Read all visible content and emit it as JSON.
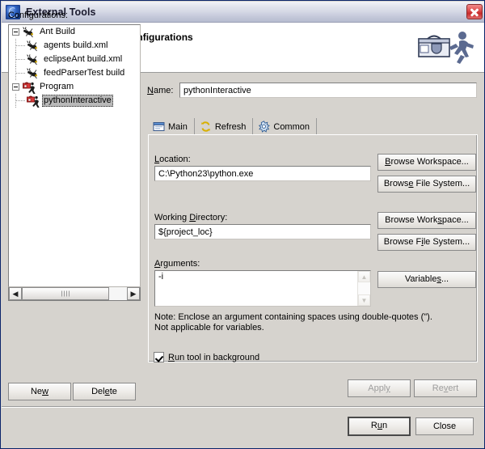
{
  "window": {
    "title": "External Tools",
    "app_icon": "eclipse-globe-icon",
    "close_icon": "close-icon"
  },
  "banner": {
    "title": "Create, manage, and run configurations",
    "icon": "external-tools-runner-icon"
  },
  "configurations": {
    "label": "Configurations:",
    "tree": [
      {
        "label": "Ant Build",
        "icon": "ant-icon",
        "level": 1,
        "expanded": true,
        "selected": false
      },
      {
        "label": "agents build.xml",
        "icon": "ant-icon",
        "level": 2,
        "expanded": false,
        "selected": false
      },
      {
        "label": "eclipseAnt build.xml",
        "icon": "ant-icon",
        "level": 2,
        "expanded": false,
        "selected": false
      },
      {
        "label": "feedParserTest build",
        "icon": "ant-icon",
        "level": 2,
        "expanded": false,
        "selected": false
      },
      {
        "label": "Program",
        "icon": "program-icon",
        "level": 1,
        "expanded": true,
        "selected": false
      },
      {
        "label": "pythonInteractive",
        "icon": "program-icon",
        "level": 2,
        "expanded": false,
        "selected": true
      }
    ],
    "scrollbar": {
      "left_arrow": "◀",
      "right_arrow": "▶",
      "name": "tree-horizontal-scrollbar"
    },
    "new_label": "New",
    "new_mnemonic": "w",
    "delete_label": "Delete",
    "delete_mnemonic": "e"
  },
  "details": {
    "name_label": "Name:",
    "name_mnemonic": "N",
    "name_value": "pythonInteractive",
    "name_placeholder": "",
    "tabs": [
      {
        "label": "Main",
        "icon": "main-window-icon",
        "active": true
      },
      {
        "label": "Refresh",
        "icon": "refresh-icon",
        "active": false
      },
      {
        "label": "Common",
        "icon": "common-gear-icon",
        "active": false
      }
    ],
    "location": {
      "label": "Location:",
      "mnemonic": "L",
      "value": "C:\\Python23\\python.exe",
      "placeholder": ""
    },
    "working_directory": {
      "label": "Working Directory:",
      "mnemonic": "D",
      "value": "${project_loc}",
      "placeholder": ""
    },
    "arguments": {
      "label": "Arguments:",
      "mnemonic": "A",
      "value": "-i",
      "placeholder": "",
      "scroll_up": "▲",
      "scroll_down": "▼"
    },
    "note_line1": "Note: Enclose an argument containing spaces using double-quotes (\").",
    "note_line2": "Not applicable for variables.",
    "run_in_background": {
      "label": "Run tool in background",
      "mnemonic": "R",
      "checked": true
    },
    "browse_workspace_1": "Browse Workspace...",
    "browse_file_system_1": "Browse File System...",
    "browse_workspace_2": "Browse Workspace...",
    "browse_file_system_2": "Browse File System...",
    "variables_label": "Variables...",
    "apply_label": "Apply",
    "apply_enabled": false,
    "revert_label": "Revert",
    "revert_enabled": false
  },
  "footer": {
    "run_label": "Run",
    "run_mnemonic": "u",
    "run_default": true,
    "close_label": "Close"
  },
  "colors": {
    "dialog_bg": "#d6d3ce",
    "title_bar_start": "#f2f3f8",
    "title_bar_end": "#b6bccf",
    "window_border": "#0a246a",
    "field_bg": "#ffffff",
    "selection_bg": "#b9b9b9",
    "disabled_text": "#9d9d9d",
    "close_button": "#c62b2b",
    "ant_icon": "#1c1c1c",
    "program_icon": "#c01818"
  }
}
